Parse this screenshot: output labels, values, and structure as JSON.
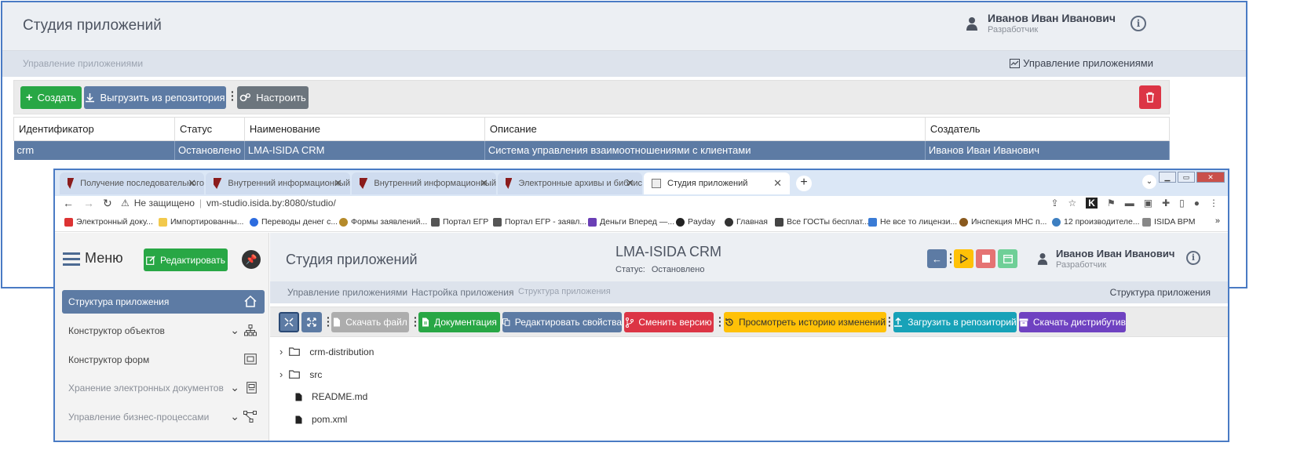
{
  "back": {
    "title": "Студия приложений",
    "user_name": "Иванов Иван Иванович",
    "user_role": "Разработчик",
    "breadcrumb": "Управление приложениями",
    "breadcrumb_right": "Управление приложениями",
    "toolbar": {
      "create": "Создать",
      "export": "Выгрузить из репозитория",
      "settings": "Настроить"
    },
    "table": {
      "headers": [
        "Идентификатор",
        "Статус",
        "Наименование",
        "Описание",
        "Создатель"
      ],
      "rows": [
        [
          "crm",
          "Остановлено",
          "LMA-ISIDA CRM",
          "Система управления взаимоотношениями с клиентами",
          "Иванов Иван Иванович"
        ]
      ]
    }
  },
  "browser": {
    "tabs": [
      {
        "label": "Получение последовательного"
      },
      {
        "label": "Внутренний информационный"
      },
      {
        "label": "Внутренний информационный"
      },
      {
        "label": "Электронные архивы и библис"
      },
      {
        "label": "Студия приложений"
      }
    ],
    "address": {
      "security": "Не защищено",
      "url": "vm-studio.isida.by:8080/studio/"
    },
    "bookmarks": [
      "Электронный доку...",
      "Импортированны...",
      "Переводы денег с...",
      "Формы заявлений...",
      "Портал ЕГР",
      "Портал ЕГР - заявл...",
      "Деньги Вперед —...",
      "Payday",
      "Главная",
      "Все ГОСТы бесплат...",
      "Не все то лицензи...",
      "Инспекция МНС п...",
      "12 производителе...",
      "ISIDA BPM"
    ]
  },
  "front": {
    "menu_label": "Меню",
    "edit_button": "Редактировать",
    "sidebar": [
      {
        "label": "Структура приложения",
        "icon": "home-icon"
      },
      {
        "label": "Конструктор объектов",
        "icon": "hierarchy-icon"
      },
      {
        "label": "Конструктор форм",
        "icon": "form-icon"
      },
      {
        "label": "Хранение электронных документов",
        "icon": "document-icon"
      },
      {
        "label": "Управление бизнес-процессами",
        "icon": "process-icon"
      }
    ],
    "title": "Студия приложений",
    "app_name": "LMA-ISIDA CRM",
    "status_label": "Статус:",
    "status_value": "Остановлено",
    "user_name": "Иванов Иван Иванович",
    "user_role": "Разработчик",
    "breadcrumb": [
      "Управление приложениями",
      "Настройка приложения",
      "Структура приложения"
    ],
    "breadcrumb_right": "Структура приложения",
    "toolbar": {
      "download_file": "Скачать файл",
      "documentation": "Документация",
      "edit_props": "Редактировать свойства",
      "change_version": "Сменить версию",
      "history": "Просмотреть историю изменений",
      "upload_repo": "Загрузить в репозиторий",
      "download_dist": "Скачать дистрибутив"
    },
    "tree": [
      {
        "label": "crm-distribution",
        "type": "folder"
      },
      {
        "label": "src",
        "type": "folder"
      },
      {
        "label": "README.md",
        "type": "file"
      },
      {
        "label": "pom.xml",
        "type": "file"
      }
    ]
  },
  "colors": {
    "green": "#28a745",
    "blue_gray": "#5d7ba4",
    "red": "#dc3545",
    "yellow": "#ffc107",
    "teal": "#17a2b8",
    "purple": "#6f42c1",
    "gray": "#6c757d"
  }
}
